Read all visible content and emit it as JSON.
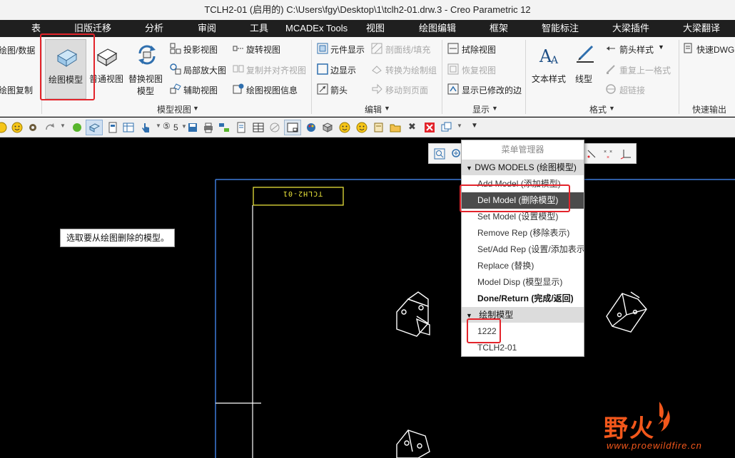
{
  "window": {
    "title": "TCLH2-01 (启用的) C:\\Users\\fgy\\Desktop\\1\\tclh2-01.drw.3 - Creo Parametric 12"
  },
  "tabs": [
    "表",
    "旧版迁移",
    "分析",
    "审阅",
    "工具",
    "MCADEx Tools",
    "视图",
    "绘图编辑",
    "框架",
    "智能标注",
    "大梁插件",
    "大梁翻译"
  ],
  "ribbon": {
    "left_partial": [
      "绘图/数据",
      "绘图复制"
    ],
    "model_views": {
      "draw_model": "绘图模型",
      "general_view": "普通视图",
      "replace_view_line1": "替换视图",
      "replace_view_line2": "模型",
      "projection_view": "投影视图",
      "detailed_view": "局部放大图",
      "auxiliary_view": "辅助视图",
      "revolved_view": "旋转视图",
      "copy_align_view": "复制并对齐视图",
      "drawing_view_info": "绘图视图信息",
      "group_label": "模型视图"
    },
    "edit": {
      "component_display": "元件显示",
      "cross_hatch": "剖面线/填充",
      "edge_display": "边显示",
      "convert_to_group": "转换为绘制组",
      "arrow": "箭头",
      "move_to_page": "移动到页面",
      "group_label": "编辑"
    },
    "display": {
      "erase_view": "拭除视图",
      "resume_view": "恢复视图",
      "show_modified_edges": "显示已修改的边",
      "group_label": "显示"
    },
    "format": {
      "text_style": "文本样式",
      "line_style": "线型",
      "arrow_style": "箭头样式",
      "repeat_last_format": "重复上一格式",
      "hyperlink": "超链接",
      "group_label": "格式"
    },
    "quick_output": {
      "quick_dwg": "快速DWG",
      "group_label": "快速输出"
    }
  },
  "quick_toolbar": {
    "dropdown_value": "5"
  },
  "tooltip": {
    "text": "选取要从绘图删除的模型。"
  },
  "drawing": {
    "title_block_text": "TCLH2-01"
  },
  "menu_manager": {
    "title": "菜单管理器",
    "section1": "DWG MODELS (绘图模型)",
    "items": [
      "Add Model (添加模型)",
      "Del Model (删除模型)",
      "Set Model (设置模型)",
      "Remove Rep (移除表示)",
      "Set/Add Rep (设置/添加表示)",
      "Replace (替换)",
      "Model Disp (模型显示)",
      "Done/Return (完成/返回)"
    ],
    "section2": "绘制模型",
    "models": [
      "1222",
      "TCLH2-01"
    ]
  },
  "watermark": {
    "brand": "野火",
    "url": "www.proewildfire.cn"
  },
  "colors": {
    "highlight_red": "#e3242b",
    "sheet_border": "#3d7bd9",
    "title_block": "#e8e23a",
    "selected_item_bg": "#4b4b4b",
    "watermark_orange": "#f2571b"
  }
}
